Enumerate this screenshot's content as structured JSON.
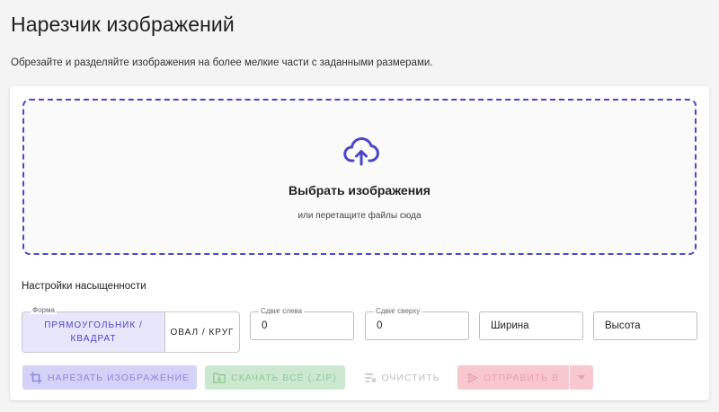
{
  "page": {
    "title": "Нарезчик изображений",
    "subtitle": "Обрезайте и разделяйте изображения на более мелкие части с заданными размерами."
  },
  "dropzone": {
    "icon": "cloud-upload-icon",
    "title": "Выбрать изображения",
    "hint": "или перетащите файлы сюда",
    "accent": "#4a46c8"
  },
  "settings": {
    "title": "Настройки насыщенности",
    "shape": {
      "legend": "Форма",
      "options": [
        {
          "label": "Прямоугольник / квадрат",
          "selected": true
        },
        {
          "label": "Овал / круг",
          "selected": false
        }
      ]
    },
    "offset_left": {
      "label": "Сдвиг слева",
      "value": "0"
    },
    "offset_top": {
      "label": "Сдвиг сверху",
      "value": "0"
    },
    "width": {
      "placeholder": "Ширина"
    },
    "height": {
      "placeholder": "Высота"
    }
  },
  "actions": {
    "slice_label": "Нарезать изображение",
    "download_label": "Скачать всё (.zip)",
    "clear_label": "Очистить",
    "send_label": "Отправить в",
    "colors": {
      "slice": "#d4d2f6",
      "download": "#cde8d0",
      "send": "#f7c8cf"
    }
  }
}
